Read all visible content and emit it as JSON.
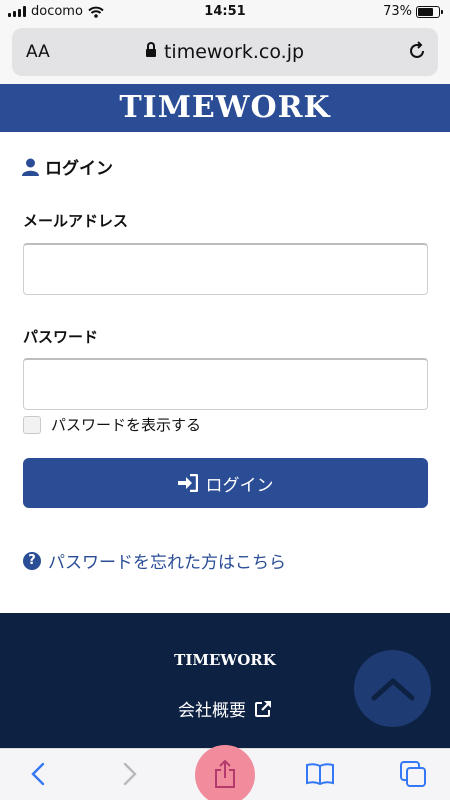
{
  "status_bar": {
    "carrier": "docomo",
    "time": "14:51",
    "battery": "73%",
    "battery_level": 0.73
  },
  "browser": {
    "text_size_label": "AA",
    "url": "timework.co.jp"
  },
  "header": {
    "logo": "TIMEWORK"
  },
  "login": {
    "title": "ログイン",
    "email_label": "メールアドレス",
    "email_value": "",
    "password_label": "パスワード",
    "password_value": "",
    "show_password_label": "パスワードを表示する",
    "submit_label": "ログイン",
    "forgot_link": "パスワードを忘れた方はこちら"
  },
  "footer": {
    "logo": "TIMEWORK",
    "company_link": "会社概要"
  },
  "colors": {
    "brand": "#2a4d96",
    "footer": "#0d2142",
    "toolbar_icon": "#3478f6"
  },
  "icons": [
    "wifi-icon",
    "lock-icon",
    "reload-icon",
    "user-icon",
    "sign-in-icon",
    "question-icon",
    "external-link-icon",
    "chevron-up-icon",
    "back-icon",
    "forward-icon",
    "share-icon",
    "bookmarks-icon",
    "tabs-icon"
  ]
}
